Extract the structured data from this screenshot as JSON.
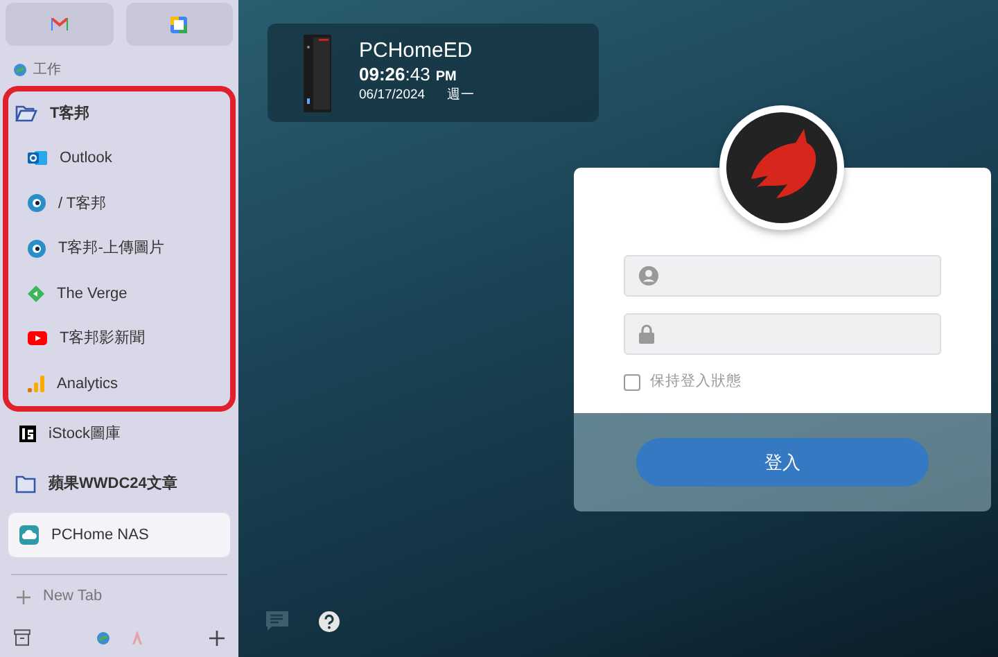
{
  "sidebar": {
    "space_label": "工作",
    "items": [
      {
        "kind": "folder",
        "label": "T客邦",
        "expanded": true,
        "highlighted": true,
        "children": [
          {
            "kind": "tab",
            "label": "Outlook",
            "selected": false
          },
          {
            "kind": "tab",
            "label": "/ T客邦",
            "selected": false
          },
          {
            "kind": "tab",
            "label": "T客邦-上傳圖片",
            "selected": false
          },
          {
            "kind": "tab",
            "label": "The Verge",
            "selected": false
          },
          {
            "kind": "tab",
            "label": "T客邦影新聞",
            "selected": false
          },
          {
            "kind": "tab",
            "label": "Analytics",
            "selected": false
          }
        ]
      },
      {
        "kind": "tab",
        "label": "iStock圖庫",
        "selected": false
      },
      {
        "kind": "folder",
        "label": "蘋果WWDC24文章",
        "expanded": false,
        "highlighted": false
      },
      {
        "kind": "tab",
        "label": "PCHome NAS",
        "selected": true
      }
    ],
    "new_tab": "New Tab"
  },
  "device": {
    "name": "PCHomeED",
    "time": "**09:26**:43",
    "ampm": "PM",
    "date": "06/17/2024",
    "weekday": "週一"
  },
  "login": {
    "remember": {
      "label": "保持登入狀態",
      "checked": false
    },
    "button": "登入"
  }
}
